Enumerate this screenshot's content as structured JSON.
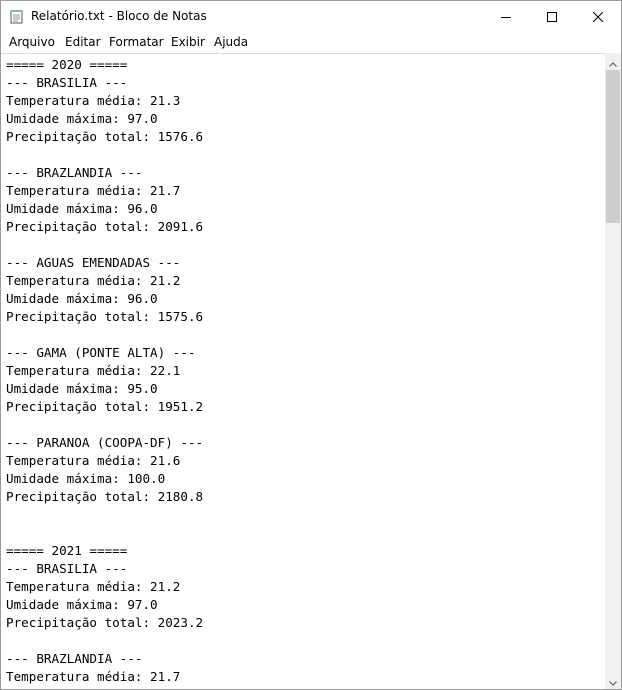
{
  "window": {
    "title": "Relatório.txt - Bloco de Notas"
  },
  "menu": {
    "items": [
      "Arquivo",
      "Editar",
      "Formatar",
      "Exibir",
      "Ajuda"
    ]
  },
  "editor": {
    "lines": [
      "===== 2020 =====",
      "--- BRASILIA ---",
      "Temperatura média: 21.3",
      "Umidade máxima: 97.0",
      "Precipitação total: 1576.6",
      "",
      "--- BRAZLANDIA ---",
      "Temperatura média: 21.7",
      "Umidade máxima: 96.0",
      "Precipitação total: 2091.6",
      "",
      "--- AGUAS EMENDADAS ---",
      "Temperatura média: 21.2",
      "Umidade máxima: 96.0",
      "Precipitação total: 1575.6",
      "",
      "--- GAMA (PONTE ALTA) ---",
      "Temperatura média: 22.1",
      "Umidade máxima: 95.0",
      "Precipitação total: 1951.2",
      "",
      "--- PARANOA (COOPA-DF) ---",
      "Temperatura média: 21.6",
      "Umidade máxima: 100.0",
      "Precipitação total: 2180.8",
      "",
      "",
      "===== 2021 =====",
      "--- BRASILIA ---",
      "Temperatura média: 21.2",
      "Umidade máxima: 97.0",
      "Precipitação total: 2023.2",
      "",
      "--- BRAZLANDIA ---",
      "Temperatura média: 21.7"
    ]
  },
  "icons": {
    "app": "notepad-icon",
    "minimize": "minimize-icon",
    "maximize": "maximize-icon",
    "close": "close-icon",
    "scroll_up": "chevron-up-icon",
    "scroll_down": "chevron-down-icon"
  }
}
